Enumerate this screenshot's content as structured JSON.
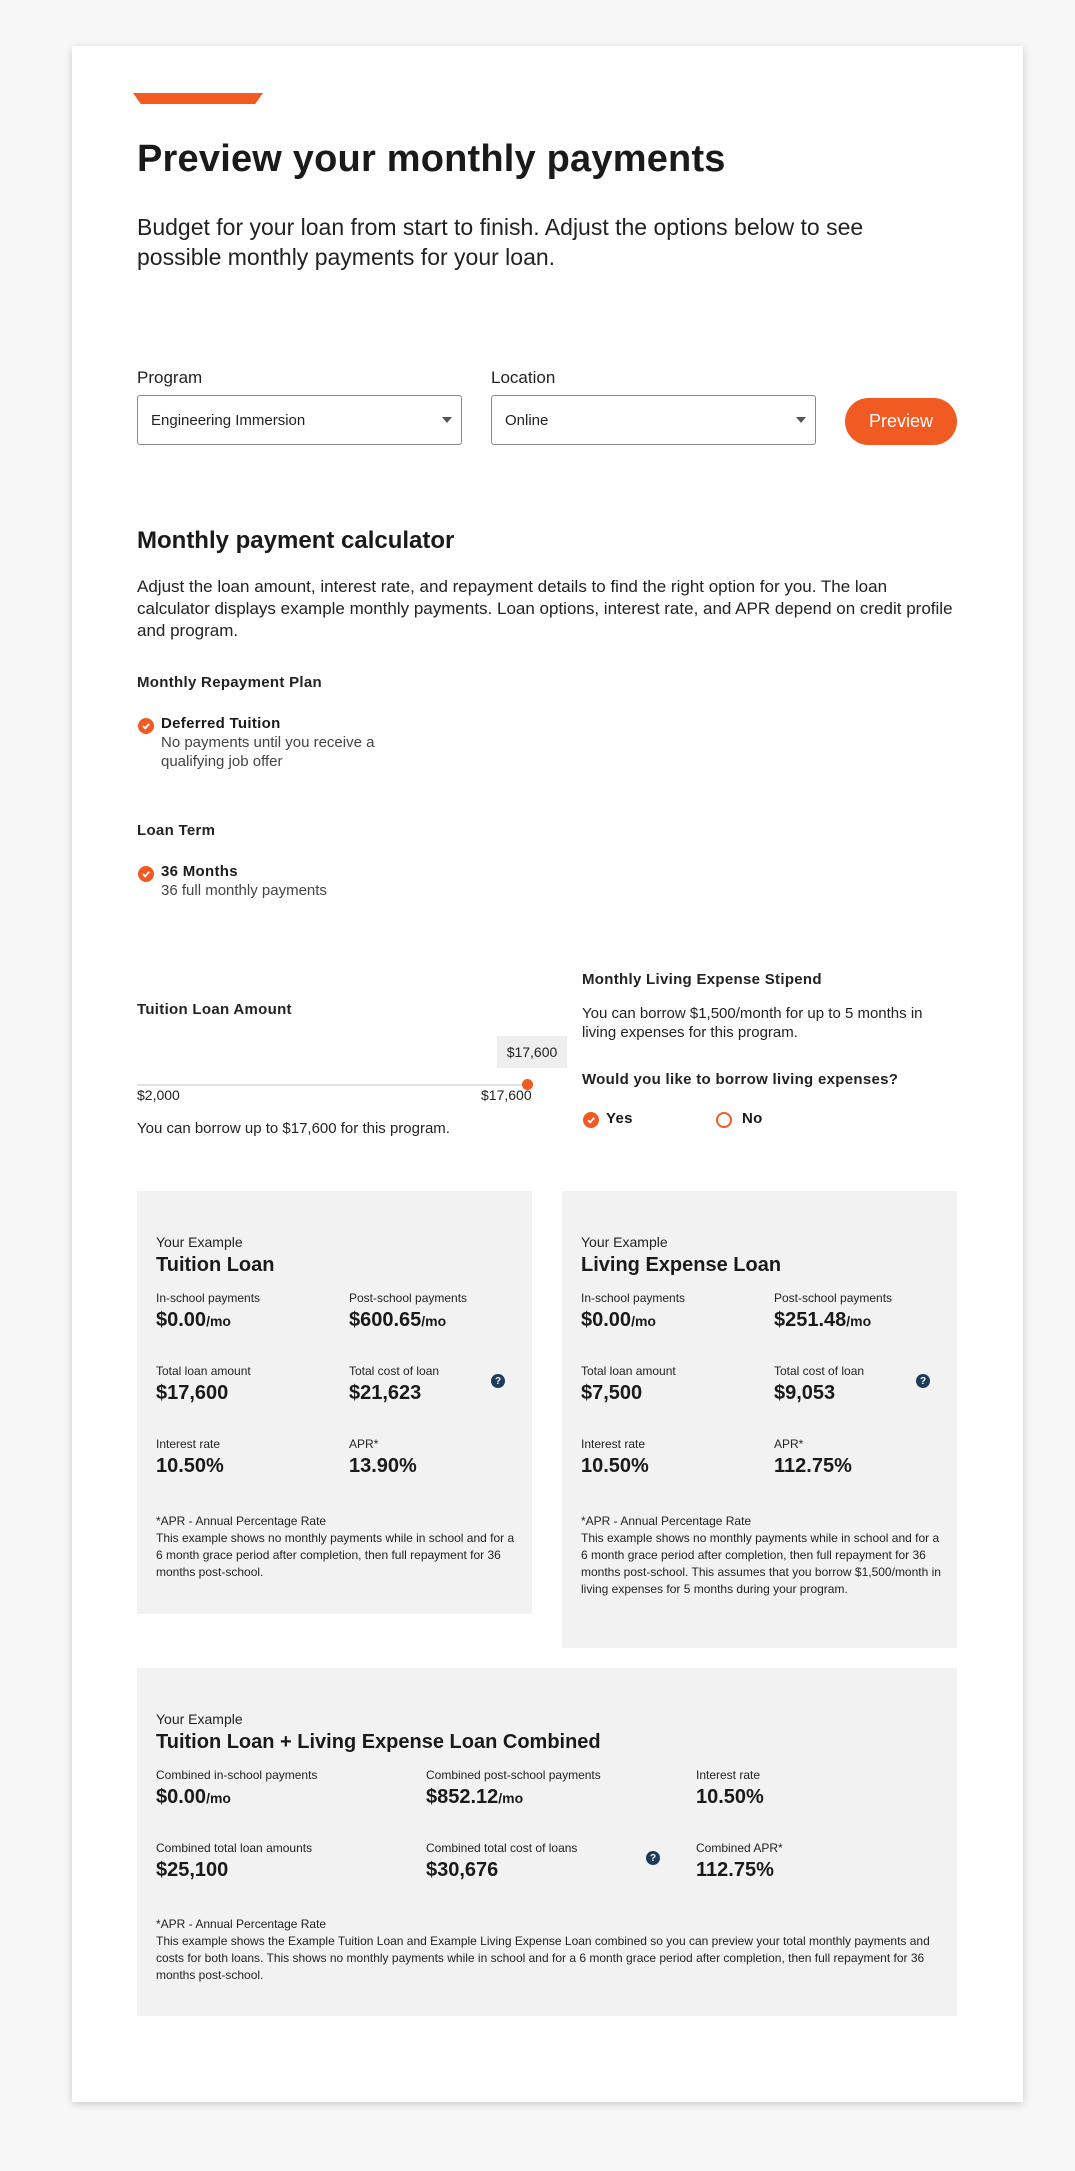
{
  "header": {
    "title": "Preview your monthly payments",
    "lead": "Budget for your loan from start to finish. Adjust the options below to see possible monthly payments for your loan."
  },
  "filters": {
    "program_label": "Program",
    "program_value": "Engineering Immersion",
    "location_label": "Location",
    "location_value": "Online",
    "preview_button": "Preview"
  },
  "calculator": {
    "title": "Monthly payment calculator",
    "description": "Adjust the loan amount, interest rate, and repayment details to find the right option for you. The loan calculator displays example monthly payments. Loan options, interest rate, and APR depend on credit profile and program.",
    "repayment_plan_label": "Monthly Repayment Plan",
    "repayment_plan": {
      "title": "Deferred Tuition",
      "desc": "No payments until you receive a qualifying job offer"
    },
    "loan_term_label": "Loan Term",
    "loan_term": {
      "title": "36 Months",
      "desc": "36 full monthly payments"
    },
    "tuition_amount_label": "Tuition Loan Amount",
    "slider": {
      "min_label": "$2,000",
      "max_label": "$17,600",
      "value_label": "$17,600",
      "fraction": 1.0
    },
    "borrow_note": "You can borrow up to $17,600 for this program.",
    "stipend_label": "Monthly Living Expense Stipend",
    "stipend_desc": "You can borrow $1,500/month for up to 5 months in living expenses for this program.",
    "stipend_question": "Would you like to borrow living expenses?",
    "yes_label": "Yes",
    "no_label": "No"
  },
  "tuition_loan": {
    "eyebrow": "Your Example",
    "title": "Tuition Loan",
    "in_school_label": "In-school payments",
    "in_school": "$0.00",
    "per_mo": "/mo",
    "post_school_label": "Post-school payments",
    "post_school": "$600.65",
    "total_amount_label": "Total loan amount",
    "total_amount": "$17,600",
    "total_cost_label": "Total cost of loan",
    "total_cost": "$21,623",
    "rate_label": "Interest rate",
    "rate": "10.50%",
    "apr_label": "APR*",
    "apr": "13.90%",
    "fine_title": "*APR - Annual Percentage Rate",
    "fine": "This example shows no monthly payments while in school and for a 6 month grace period after completion, then full repayment for 36 months post-school."
  },
  "living_loan": {
    "eyebrow": "Your Example",
    "title": "Living Expense Loan",
    "in_school_label": "In-school payments",
    "in_school": "$0.00",
    "per_mo": "/mo",
    "post_school_label": "Post-school payments",
    "post_school": "$251.48",
    "total_amount_label": "Total loan amount",
    "total_amount": "$7,500",
    "total_cost_label": "Total cost of loan",
    "total_cost": "$9,053",
    "rate_label": "Interest rate",
    "rate": "10.50%",
    "apr_label": "APR*",
    "apr": "112.75%",
    "fine_title": "*APR - Annual Percentage Rate",
    "fine": "This example shows no monthly payments while in school and for a 6 month grace period after completion, then full repayment for 36 months post-school. This assumes that you borrow $1,500/month in living expenses for 5 months during your program."
  },
  "combined": {
    "eyebrow": "Your Example",
    "title": "Tuition Loan + Living Expense Loan Combined",
    "in_school_label": "Combined in-school payments",
    "in_school": "$0.00",
    "per_mo": "/mo",
    "post_school_label": "Combined post-school payments",
    "post_school": "$852.12",
    "rate_label": "Interest rate",
    "rate": "10.50%",
    "total_amount_label": "Combined total loan amounts",
    "total_amount": "$25,100",
    "total_cost_label": "Combined total cost of loans",
    "total_cost": "$30,676",
    "apr_label": "Combined APR*",
    "apr": "112.75%",
    "fine_title": "*APR - Annual Percentage Rate",
    "fine": "This example shows the Example Tuition Loan and Example Living Expense Loan combined so you can preview your total monthly payments and costs for both loans. This shows no monthly payments while in school and for a 6 month grace period after completion, then full repayment for 36 months post-school."
  },
  "help_icon": "?",
  "colors": {
    "accent": "#f15a22",
    "help": "#1d3c5a",
    "panel": "#f2f2f2"
  }
}
